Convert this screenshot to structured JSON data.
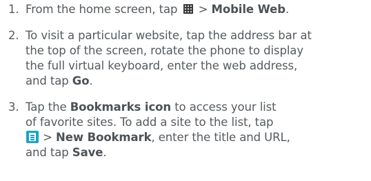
{
  "steps": [
    {
      "number": "1.",
      "lines": [
        {
          "pre": "From the home screen, tap ",
          "icon": "apps-grid-icon",
          "mid": " > ",
          "bold": "Mobile Web",
          "post": "."
        }
      ]
    },
    {
      "number": "2.",
      "lines": [
        "To visit a particular website, tap the address bar at",
        "the top of the screen, rotate the phone to display",
        "the full virtual keyboard, enter the web address,",
        {
          "pre": "and tap ",
          "bold": "Go",
          "post": "."
        }
      ]
    },
    {
      "number": "3.",
      "lines": [
        {
          "pre": "Tap the ",
          "bold": "Bookmarks icon",
          "post": " to access your list"
        },
        "of favorite sites. To add a site to the list, tap",
        {
          "icon": "menu-icon",
          "mid": " > ",
          "bold": "New Bookmark",
          "post": ", enter the title and URL,"
        },
        {
          "pre": "and tap ",
          "bold": "Save",
          "post": "."
        }
      ]
    }
  ],
  "colors": {
    "text": "#555a5e",
    "menu_icon": "#1aa3c6",
    "apps_icon": "#3b3b3b"
  }
}
